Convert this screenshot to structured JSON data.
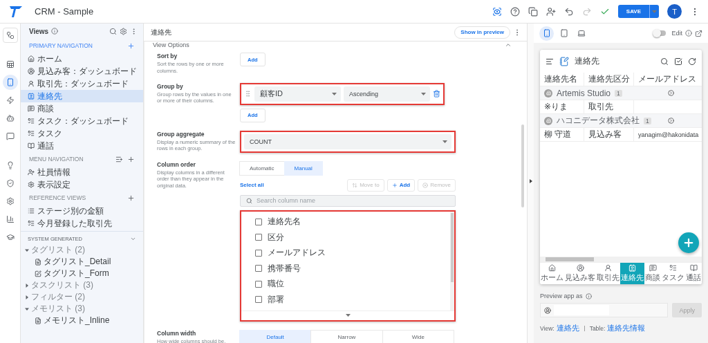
{
  "app": {
    "title": "CRM - Sample",
    "save_label": "SAVE",
    "avatar": "T"
  },
  "rail": [
    {
      "selected": false
    },
    {
      "selected": false
    },
    {
      "selected": true
    },
    {
      "selected": false
    },
    {
      "selected": false
    },
    {
      "selected": false
    },
    {
      "selected": false
    },
    {
      "selected": false
    },
    {
      "selected": false
    },
    {
      "selected": false
    },
    {
      "selected": false
    }
  ],
  "sidebar": {
    "title": "Views",
    "sections": [
      {
        "heading": "PRIMARY NAVIGATION",
        "items": [
          {
            "label": "ホーム",
            "selected": false
          },
          {
            "label": "見込み客：ダッシュボード",
            "selected": false
          },
          {
            "label": "取引先：ダッシュボード",
            "selected": false
          },
          {
            "label": "連絡先",
            "selected": true
          },
          {
            "label": "商談",
            "selected": false
          },
          {
            "label": "タスク：ダッシュボード",
            "selected": false
          },
          {
            "label": "タスク",
            "selected": false
          },
          {
            "label": "通話",
            "selected": false
          }
        ]
      },
      {
        "heading": "MENU NAVIGATION",
        "items": [
          {
            "label": "社員情報",
            "selected": false
          },
          {
            "label": "表示設定",
            "selected": false
          }
        ]
      },
      {
        "heading": "REFERENCE VIEWS",
        "items": [
          {
            "label": "ステージ別の金額",
            "selected": false
          },
          {
            "label": "今月登録した取引先",
            "selected": false
          }
        ]
      }
    ],
    "system": {
      "heading": "SYSTEM GENERATED",
      "expanded": true,
      "tree": [
        {
          "label": "タグリスト",
          "count": "(2)",
          "expanded": true,
          "children": [
            {
              "label": "タグリスト_Detail"
            },
            {
              "label": "タグリスト_Form"
            }
          ]
        },
        {
          "label": "タスクリスト",
          "count": "(3)",
          "expanded": false
        },
        {
          "label": "フィルター",
          "count": "(2)",
          "expanded": false
        },
        {
          "label": "メモリスト",
          "count": "(3)",
          "expanded": true,
          "children": [
            {
              "label": "メモリスト_Inline"
            }
          ]
        }
      ]
    }
  },
  "main": {
    "title": "連絡先",
    "preview_button": "Show in preview",
    "panel_title": "View Options",
    "options": [
      {
        "kind": "add",
        "label": "Sort by",
        "hint": "Sort the rows by one or more columns.",
        "button": "Add"
      },
      {
        "kind": "group",
        "label": "Group by",
        "hint": "Group rows by the values in one or more of their columns.",
        "highlighted": true,
        "column": "顧客ID",
        "order": "Ascending",
        "button": "Add"
      },
      {
        "kind": "select",
        "label": "Group aggregate",
        "hint": "Display a numeric summary of the rows in each group.",
        "highlighted": true,
        "value": "COUNT"
      },
      {
        "kind": "columns",
        "label": "Column order",
        "hint": "Display columns in a different order than they appear in the original data.",
        "modes": [
          {
            "label": "Automatic",
            "selected": false
          },
          {
            "label": "Manual",
            "selected": true
          }
        ],
        "select_all": "Select all",
        "actions": [
          {
            "label": "Move to",
            "disabled": true
          },
          {
            "label": "Add",
            "disabled": false
          },
          {
            "label": "Remove",
            "disabled": true
          }
        ],
        "search_placeholder": "Search column name",
        "highlighted": true,
        "columns": [
          {
            "label": "連絡先名",
            "checked": false
          },
          {
            "label": "区分",
            "checked": false
          },
          {
            "label": "メールアドレス",
            "checked": false
          },
          {
            "label": "携帯番号",
            "checked": false
          },
          {
            "label": "職位",
            "checked": false
          },
          {
            "label": "部署",
            "checked": false
          }
        ]
      },
      {
        "kind": "segments",
        "label": "Column width",
        "hint": "How wide columns should be.",
        "modes": [
          {
            "label": "Default",
            "selected": true
          },
          {
            "label": "Narrow",
            "selected": false
          },
          {
            "label": "Wide",
            "selected": false
          }
        ]
      }
    ]
  },
  "preview": {
    "devices": [
      {
        "selected": true
      },
      {
        "selected": false
      },
      {
        "selected": false
      }
    ],
    "edit_toggle": {
      "label": "Edit",
      "on": false
    },
    "app": {
      "title": "連絡先",
      "columns": [
        "連絡先名",
        "連絡先区分",
        "メールアドレス"
      ],
      "rows": [
        {
          "kind": "group",
          "label": "Artemis Studio",
          "count": "1"
        },
        {
          "kind": "row",
          "cells": [
            "※りま",
            "取引先"
          ]
        },
        {
          "kind": "group",
          "label": "ハコニデータ株式会社",
          "count": "1"
        },
        {
          "kind": "row",
          "cells": [
            "柳 守道",
            "見込み客",
            "yanagim@hakonidata"
          ]
        }
      ],
      "nav": [
        {
          "label": "ホーム",
          "selected": false
        },
        {
          "label": "見込み客",
          "selected": false
        },
        {
          "label": "取引先",
          "selected": false
        },
        {
          "label": "連絡先",
          "selected": true
        },
        {
          "label": "商談",
          "selected": false
        },
        {
          "label": "タスク",
          "selected": false
        },
        {
          "label": "通話",
          "selected": false
        }
      ]
    },
    "preview_as": {
      "label": "Preview app as",
      "button": "Apply",
      "button_disabled": true
    },
    "footer": {
      "view_label": "View:",
      "view": "連絡先",
      "table_label": "Table:",
      "table": "連絡先情報"
    }
  }
}
